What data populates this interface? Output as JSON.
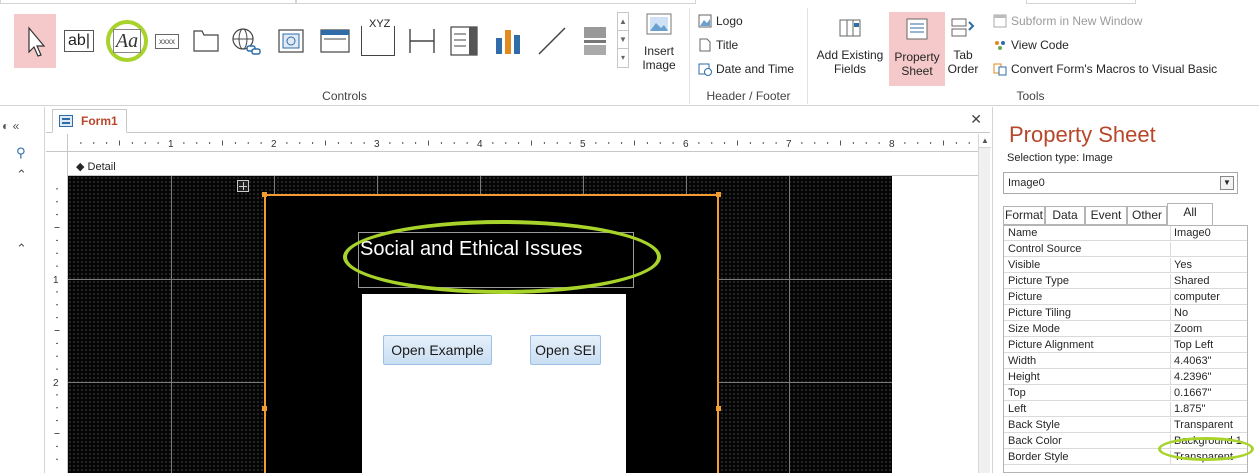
{
  "ribbon": {
    "controls_group_label": "Controls",
    "insert_image_label": "Insert Image",
    "header_footer": {
      "group_label": "Header / Footer",
      "logo_label": "Logo",
      "title_label": "Title",
      "date_time_label": "Date and Time"
    },
    "tools": {
      "group_label": "Tools",
      "add_existing_fields_label": "Add Existing Fields",
      "property_sheet_label": "Property Sheet",
      "tab_order_label": "Tab Order",
      "subform_new_window_label": "Subform in New Window",
      "view_code_label": "View Code",
      "convert_macros_label": "Convert Form's Macros to Visual Basic"
    },
    "controls": [
      {
        "name": "select-pointer-icon",
        "selected": true
      },
      {
        "name": "text-box-icon",
        "text": "ab|"
      },
      {
        "name": "label-icon",
        "text": "Aa"
      },
      {
        "name": "button-icon",
        "text": "xxxx"
      },
      {
        "name": "tab-control-icon"
      },
      {
        "name": "hyperlink-icon"
      },
      {
        "name": "web-browser-control-icon"
      },
      {
        "name": "navigation-control-icon"
      },
      {
        "name": "option-group-icon",
        "text": "XYZ"
      },
      {
        "name": "page-break-icon"
      },
      {
        "name": "combo-box-icon"
      },
      {
        "name": "chart-icon"
      },
      {
        "name": "line-icon"
      },
      {
        "name": "toggle-button-icon"
      }
    ],
    "label_highlight_color": "#a8d32a"
  },
  "document": {
    "tab_label": "Form1",
    "detail_label": "Detail",
    "form": {
      "title_text": "Social and Ethical Issues",
      "buttons": [
        {
          "label": "Open Example"
        },
        {
          "label": "Open SEI"
        }
      ]
    },
    "ruler_numbers": [
      "1",
      "2",
      "3",
      "4",
      "5",
      "6",
      "7",
      "8"
    ],
    "vruler_numbers": [
      "1",
      "2"
    ]
  },
  "property_sheet": {
    "title": "Property Sheet",
    "selection_type_label": "Selection type:  Image",
    "selected_control": "Image0",
    "tabs": [
      "Format",
      "Data",
      "Event",
      "Other",
      "All"
    ],
    "active_tab": "All",
    "rows": [
      {
        "k": "Name",
        "v": "Image0"
      },
      {
        "k": "Control Source",
        "v": ""
      },
      {
        "k": "Visible",
        "v": "Yes"
      },
      {
        "k": "Picture Type",
        "v": "Shared"
      },
      {
        "k": "Picture",
        "v": "computer"
      },
      {
        "k": "Picture Tiling",
        "v": "No"
      },
      {
        "k": "Size Mode",
        "v": "Zoom"
      },
      {
        "k": "Picture Alignment",
        "v": "Top Left"
      },
      {
        "k": "Width",
        "v": "4.4063\""
      },
      {
        "k": "Height",
        "v": "4.2396\""
      },
      {
        "k": "Top",
        "v": "0.1667\""
      },
      {
        "k": "Left",
        "v": "1.875\""
      },
      {
        "k": "Back Style",
        "v": "Transparent"
      },
      {
        "k": "Back Color",
        "v": "Background 1"
      },
      {
        "k": "Border Style",
        "v": "Transparent"
      }
    ]
  },
  "colors": {
    "accent": "#b7472a",
    "selection": "#f5c9c9",
    "highlight_green": "#a8d32a",
    "image_border": "#f39c32"
  }
}
